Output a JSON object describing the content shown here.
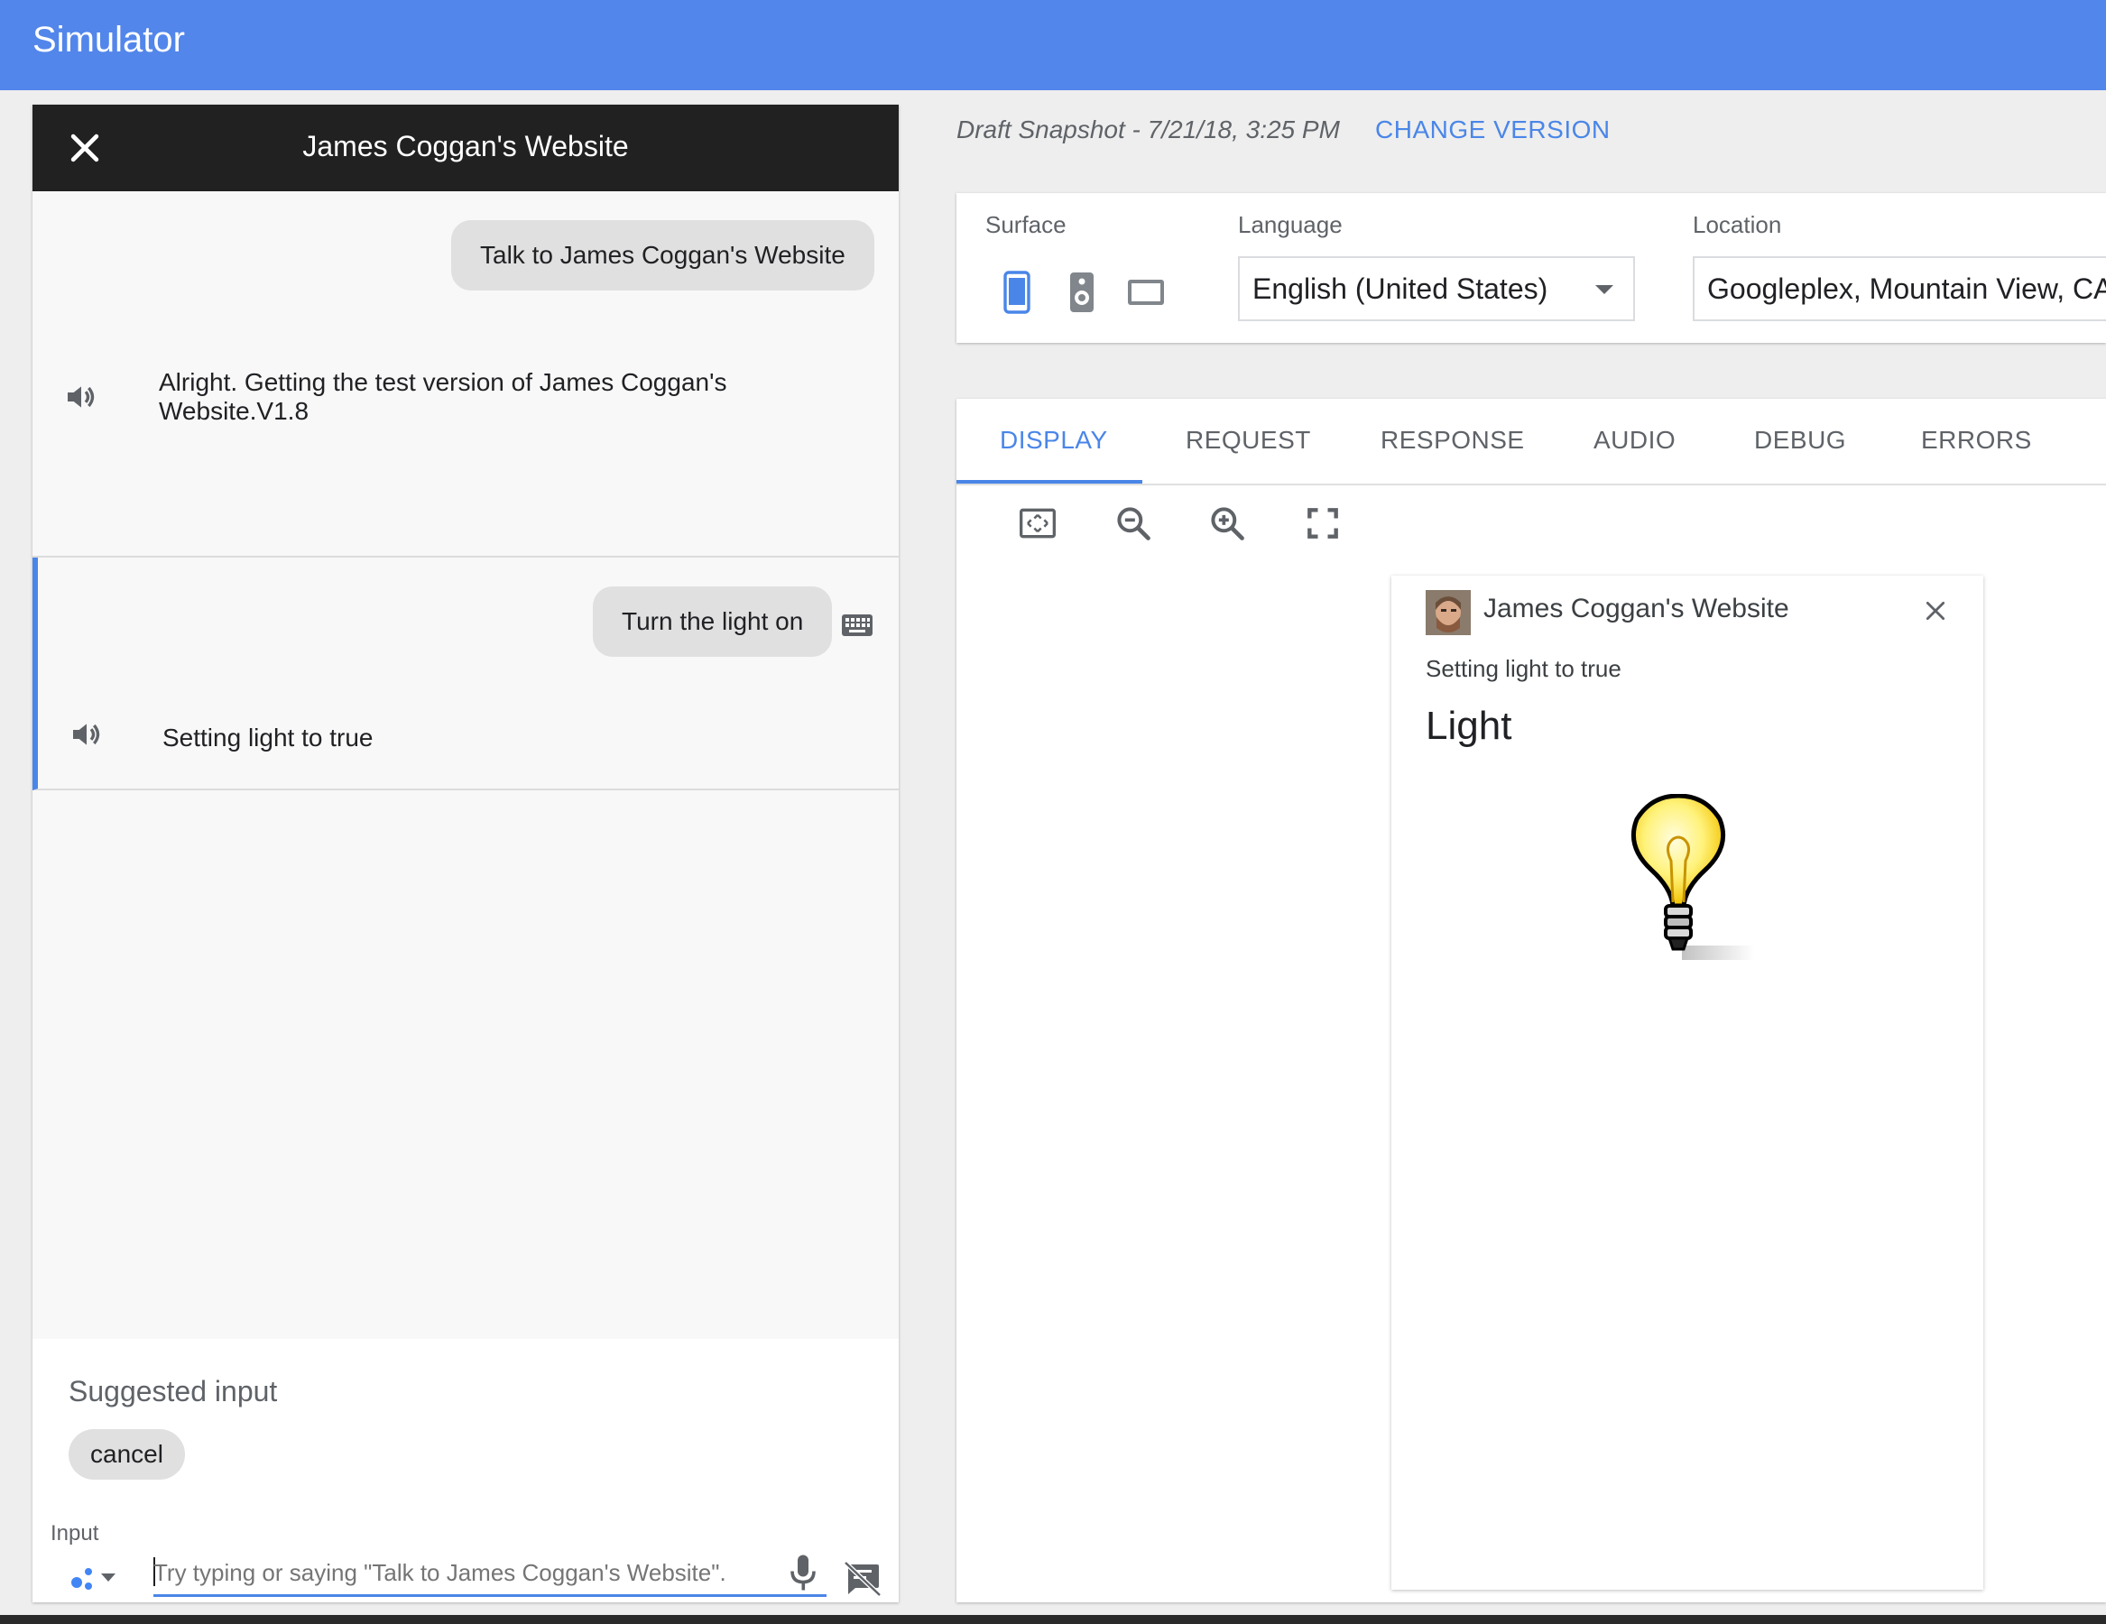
{
  "app": {
    "title": "Simulator"
  },
  "chat": {
    "header_title": "James Coggan's Website",
    "turns": [
      {
        "user": "Talk to James Coggan's Website",
        "assistant": "Alright. Getting the test version of James Coggan's Website.V1.8"
      },
      {
        "user": "Turn the light on",
        "assistant": "Setting light to true"
      }
    ],
    "suggested_label": "Suggested input",
    "suggestions": [
      "cancel"
    ],
    "input_label": "Input",
    "input_placeholder": "Try typing or saying \"Talk to James Coggan's Website\"."
  },
  "version": {
    "snapshot": "Draft Snapshot - 7/21/18, 3:25 PM",
    "change_label": "CHANGE VERSION"
  },
  "settings": {
    "surface_label": "Surface",
    "language_label": "Language",
    "language_value": "English (United States)",
    "location_label": "Location",
    "location_value": "Googleplex, Mountain View, CA"
  },
  "tabs": [
    "DISPLAY",
    "REQUEST",
    "RESPONSE",
    "AUDIO",
    "DEBUG",
    "ERRORS"
  ],
  "active_tab": "DISPLAY",
  "display": {
    "app_name": "James Coggan's Website",
    "speech": "Setting light to true",
    "card_title": "Light",
    "image_icon": "lightbulb-icon"
  },
  "colors": {
    "accent": "#4a86e8",
    "topbar": "#5286eb",
    "chat_header": "#212121"
  }
}
